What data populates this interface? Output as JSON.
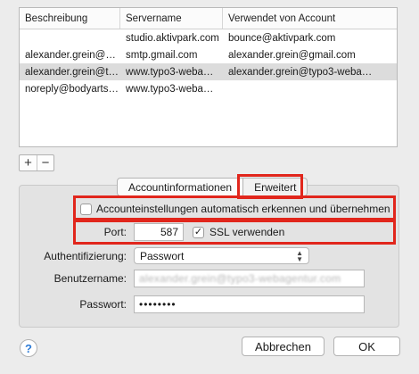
{
  "table": {
    "headers": [
      "Beschreibung",
      "Servername",
      "Verwendet von Account"
    ],
    "rows": [
      [
        "",
        "studio.aktivpark.com",
        "bounce@aktivpark.com"
      ],
      [
        "alexander.grein@g…",
        "smtp.gmail.com",
        "alexander.grein@gmail.com"
      ],
      [
        "alexander.grein@t…",
        "www.typo3-weba…",
        "alexander.grein@typo3-weba…"
      ],
      [
        "noreply@bodyarts…",
        "www.typo3-weba…",
        ""
      ]
    ],
    "selected_row": 2
  },
  "controls": {
    "add": "+",
    "remove": "−"
  },
  "tabs": {
    "info": "Accountinformationen",
    "advanced": "Erweitert"
  },
  "auto_settings": {
    "label": "Accounteinstellungen automatisch erkennen und übernehmen",
    "checked": false
  },
  "port": {
    "label": "Port:",
    "value": "587"
  },
  "ssl": {
    "label": "SSL verwenden",
    "checked": true,
    "mark": "✓"
  },
  "auth": {
    "label": "Authentifizierung:",
    "value": "Passwort"
  },
  "username": {
    "label": "Benutzername:",
    "value": "alexander.grein@typo3-webagentur.com"
  },
  "password": {
    "label": "Passwort:",
    "value": "••••••••"
  },
  "footer": {
    "help": "?",
    "cancel": "Abbrechen",
    "ok": "OK"
  },
  "colors": {
    "highlight": "#e1261c",
    "selected_row": "#dcdcdc"
  }
}
